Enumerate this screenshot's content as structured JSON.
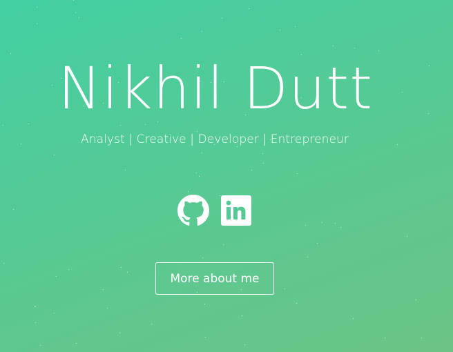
{
  "hero": {
    "name": "Nikhil Dutt",
    "tagline": "Analyst | Creative | Developer | Entrepreneur",
    "background": {
      "gradient_start": "#42cfa2",
      "gradient_end": "#6cc485"
    },
    "socials": [
      {
        "icon": "github-icon"
      },
      {
        "icon": "linkedin-icon"
      }
    ],
    "cta_label": "More about me"
  }
}
